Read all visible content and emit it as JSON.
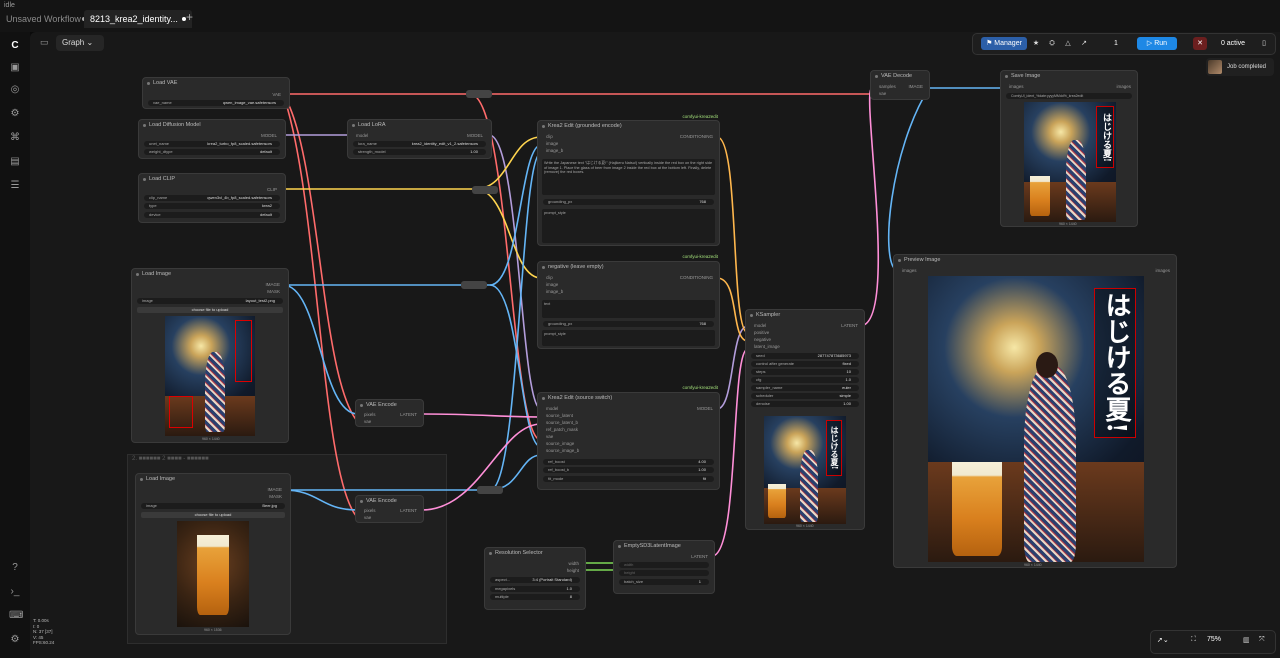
{
  "app_label": "idle",
  "tabs": [
    {
      "label": "Unsaved Workflow"
    },
    {
      "label": "8213_krea2_identity..."
    }
  ],
  "toolbar": {
    "graph_label": "Graph",
    "manager_label": "Manager",
    "queue_count": "1",
    "run_label": "Run",
    "active_label": "0 active",
    "job_label": "Job completed"
  },
  "zoom": "75%",
  "stats": [
    "T: 0.00s",
    "I: 0",
    "N: 37 [37]",
    "V: 45",
    "FPS:60.24"
  ],
  "group_title": "2. ■■■■■■ 2 ■■■■ - ■■■■■■",
  "nodes": {
    "load_vae": {
      "title": "Load VAE",
      "out": "VAE",
      "field": "vae_name",
      "value": "qwen_image_vae.safetensors"
    },
    "load_diffusion": {
      "title": "Load Diffusion Model",
      "out": "MODEL",
      "f1": "unet_name",
      "v1": "krea2_turbo_fp8_scaled.safetensors",
      "f2": "weight_dtype",
      "v2": "default"
    },
    "load_lora": {
      "title": "Load LoRA",
      "in": "model",
      "out": "MODEL",
      "f1": "lora_name",
      "v1": "krea2_identity_edit_v1_2.safetensors",
      "f2": "strength_model",
      "v2": "1.00"
    },
    "load_clip": {
      "title": "Load CLIP",
      "out": "CLIP",
      "f1": "clip_name",
      "v1": "qwen3vl_4b_fp8_scaled.safetensors",
      "f2": "type",
      "v2": "krea2",
      "f3": "device",
      "v3": "default"
    },
    "load_image1": {
      "title": "Load Image",
      "o1": "IMAGE",
      "o2": "MASK",
      "field": "image",
      "value": "layout_test2.png",
      "upload": "choose file to upload",
      "size": "960 × 1440"
    },
    "load_image2": {
      "title": "Load Image",
      "o1": "IMAGE",
      "o2": "MASK",
      "field": "image",
      "value": "Beer.jpg",
      "upload": "choose file to upload",
      "size": "960 × 1536"
    },
    "vae_encode1": {
      "title": "VAE Encode",
      "i1": "pixels",
      "i2": "vae",
      "out": "LATENT"
    },
    "vae_encode2": {
      "title": "VAE Encode",
      "i1": "pixels",
      "i2": "vae",
      "out": "LATENT"
    },
    "krea_edit_pos": {
      "tag": "comfyui-krea2edit",
      "title": "Krea2 Edit (grounded encode)",
      "i1": "clip",
      "i2": "image",
      "i3": "image_b",
      "out": "CONDITIONING",
      "text": "Write the Japanese text \"はじける夏!\" (Hajikeru Natsu!) vertically inside the red box on the right side of image 1. Place the glass of beer from image 2 inside the red box at the bottom left. Finally, delete (remove) the red boxes.",
      "f": "grounding_px",
      "v": "768",
      "sub": "prompt_style"
    },
    "krea_edit_neg": {
      "tag": "comfyui-krea2edit",
      "title": "negative (leave empty)",
      "i1": "clip",
      "i2": "image",
      "i3": "image_b",
      "out": "CONDITIONING",
      "text": "text",
      "f": "grounding_px",
      "v": "768",
      "sub": "prompt_style"
    },
    "krea_switch": {
      "tag": "comfyui-krea2edit",
      "title": "Krea2 Edit (source switch)",
      "out": "MODEL",
      "inputs": [
        "model",
        "source_latent",
        "source_latent_b",
        "ref_patch_mask",
        "vae",
        "source_image",
        "source_image_b"
      ],
      "f1": "ref_boost",
      "v1": "4.00",
      "f2": "ref_boost_b",
      "v2": "1.00",
      "f3": "fit_mode",
      "v3": "fit"
    },
    "ksampler": {
      "title": "KSampler",
      "inputs": [
        "model",
        "positive",
        "negative",
        "latent_image"
      ],
      "out": "LATENT",
      "fields": [
        [
          "seed",
          "287747873685973"
        ],
        [
          "control after generate",
          "fixed"
        ],
        [
          "steps",
          "10"
        ],
        [
          "cfg",
          "1.0"
        ],
        [
          "sampler_name",
          "euler"
        ],
        [
          "scheduler",
          "simple"
        ],
        [
          "denoise",
          "1.00"
        ]
      ],
      "size": "960 × 1440"
    },
    "vae_decode": {
      "title": "VAE Decode",
      "i1": "samples",
      "i2": "vae",
      "out": "IMAGE"
    },
    "save_image": {
      "title": "Save Image",
      "in": "images",
      "out": "images",
      "field": "ComfyUI_ident_%date:yyyyMMdd%_krea2edit",
      "size": "960 × 1440"
    },
    "preview_image": {
      "title": "Preview Image",
      "in": "images",
      "out": "images",
      "size": "960 × 1440"
    },
    "resolution": {
      "title": "Resolution Selector",
      "o1": "width",
      "o2": "height",
      "fields": [
        [
          "aspect...",
          "3:4 (Portrait Standard)"
        ],
        [
          "megapixels",
          "1.0"
        ],
        [
          "multiple",
          "8"
        ]
      ]
    },
    "empty_latent": {
      "title": "EmptySD3LatentImage",
      "out": "LATENT",
      "f1": "width",
      "f2": "height",
      "f3": "batch_size",
      "v3": "1"
    }
  },
  "sign_text": "はじける夏!",
  "colors": {
    "vae": "#ff6b6b",
    "model": "#b39ddb",
    "clip": "#ffd54f",
    "image": "#64b5f6",
    "latent": "#ff8fd8",
    "conditioning": "#ffb74d",
    "int": "#7ed957",
    "run": "#1e88e5"
  }
}
